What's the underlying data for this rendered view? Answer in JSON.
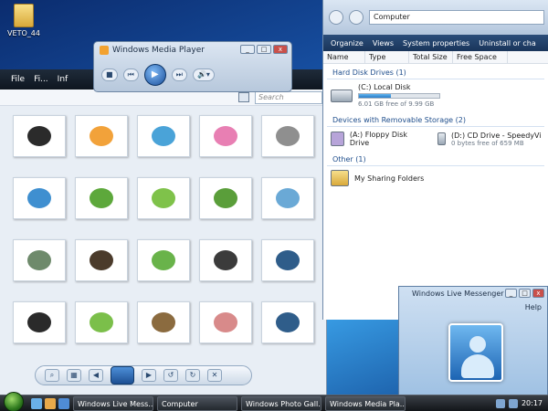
{
  "desktop": {
    "icon_label": "VETO_44"
  },
  "gallery": {
    "menu": [
      "File",
      "Fi...",
      "Inf"
    ],
    "search_placeholder": "Search",
    "thumbnails": [
      {
        "name": "panda",
        "color": "#2b2b2b"
      },
      {
        "name": "starfish",
        "color": "#f2a23a"
      },
      {
        "name": "toucan",
        "color": "#4aa3d8"
      },
      {
        "name": "flamingo",
        "color": "#e87fb3"
      },
      {
        "name": "koala",
        "color": "#8f8f8f"
      },
      {
        "name": "bird-sky",
        "color": "#3f8fd0"
      },
      {
        "name": "frog",
        "color": "#5da83b"
      },
      {
        "name": "chameleon",
        "color": "#7fc24a"
      },
      {
        "name": "turtle",
        "color": "#5a9e3a"
      },
      {
        "name": "elephant",
        "color": "#6aa9d6"
      },
      {
        "name": "tortoise",
        "color": "#6e8a6b"
      },
      {
        "name": "monkey",
        "color": "#4b3b2b"
      },
      {
        "name": "frogs",
        "color": "#69b34a"
      },
      {
        "name": "panda-small",
        "color": "#3b3b3b"
      },
      {
        "name": "scorpion",
        "color": "#2f5d8a"
      },
      {
        "name": "crow",
        "color": "#2a2a2a"
      },
      {
        "name": "chameleon-2",
        "color": "#7bbf4a"
      },
      {
        "name": "mouse",
        "color": "#8b6b3f"
      },
      {
        "name": "lizard",
        "color": "#d88a8a"
      },
      {
        "name": "scorpion-2",
        "color": "#2f5d8a"
      }
    ]
  },
  "media_player": {
    "title": "Windows Media Player",
    "minimize": "_",
    "maximize": "□",
    "close": "x"
  },
  "explorer": {
    "address": "Computer",
    "toolbar": [
      "Organize",
      "Views",
      "System properties",
      "Uninstall or cha"
    ],
    "columns": [
      "Name",
      "Type",
      "Total Size",
      "Free Space"
    ],
    "group_hdd": "Hard Disk Drives (1)",
    "local_disk": {
      "name": "(C:) Local Disk",
      "free": "6.01 GB free of 9.99 GB",
      "used_fraction": 0.4
    },
    "group_removable": "Devices with Removable Storage (2)",
    "floppy": {
      "name": "(A:) Floppy Disk Drive"
    },
    "cd": {
      "name": "(D:) CD Drive - SpeedyVis",
      "free": "0 bytes free of 659 MB"
    },
    "group_other": "Other (1)",
    "sharing": {
      "name": "My Sharing Folders"
    }
  },
  "messenger": {
    "title": "Windows Live Messenger",
    "help": "Help"
  },
  "taskbar": {
    "tasks": [
      "Windows Live Mess...",
      "Computer",
      "Windows Photo Gall...",
      "Windows Media Pla..."
    ],
    "clock": "20:17"
  }
}
